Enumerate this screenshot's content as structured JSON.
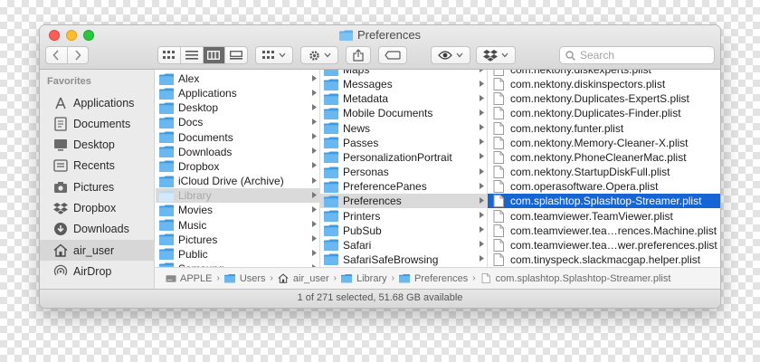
{
  "window": {
    "title": "Preferences"
  },
  "toolbar": {
    "search_placeholder": "Search",
    "back_icon": "chevron-left-icon",
    "forward_icon": "chevron-right-icon",
    "view_modes": [
      "icon-view-icon",
      "list-view-icon",
      "column-view-icon",
      "gallery-view-icon"
    ],
    "active_view": "column-view-icon"
  },
  "sidebar": {
    "heading": "Favorites",
    "items": [
      {
        "label": "Applications",
        "icon": "applications-icon"
      },
      {
        "label": "Documents",
        "icon": "documents-icon"
      },
      {
        "label": "Desktop",
        "icon": "desktop-icon"
      },
      {
        "label": "Recents",
        "icon": "recents-icon"
      },
      {
        "label": "Pictures",
        "icon": "pictures-icon"
      },
      {
        "label": "Dropbox",
        "icon": "dropbox-icon"
      },
      {
        "label": "Downloads",
        "icon": "downloads-icon"
      },
      {
        "label": "air_user",
        "icon": "home-icon",
        "selected": true
      },
      {
        "label": "AirDrop",
        "icon": "airdrop-icon"
      }
    ]
  },
  "columns": {
    "col1": [
      {
        "label": "Alex"
      },
      {
        "label": "Applications"
      },
      {
        "label": "Desktop"
      },
      {
        "label": "Docs"
      },
      {
        "label": "Documents"
      },
      {
        "label": "Downloads"
      },
      {
        "label": "Dropbox"
      },
      {
        "label": "iCloud Drive (Archive)"
      },
      {
        "label": "Library",
        "state": "highlighted"
      },
      {
        "label": "Movies"
      },
      {
        "label": "Music"
      },
      {
        "label": "Pictures"
      },
      {
        "label": "Public"
      },
      {
        "label": "Samsung"
      }
    ],
    "col2": [
      {
        "label": "Maps"
      },
      {
        "label": "Messages"
      },
      {
        "label": "Metadata"
      },
      {
        "label": "Mobile Documents"
      },
      {
        "label": "News"
      },
      {
        "label": "Passes"
      },
      {
        "label": "PersonalizationPortrait"
      },
      {
        "label": "Personas"
      },
      {
        "label": "PreferencePanes"
      },
      {
        "label": "Preferences",
        "state": "highlighted"
      },
      {
        "label": "Printers"
      },
      {
        "label": "PubSub"
      },
      {
        "label": "Safari"
      },
      {
        "label": "SafariSafeBrowsing"
      }
    ],
    "col3": [
      {
        "label": "com.nektony.diskexperts.plist"
      },
      {
        "label": "com.nektony.diskinspectors.plist"
      },
      {
        "label": "com.nektony.Duplicates-ExpertS.plist"
      },
      {
        "label": "com.nektony.Duplicates-Finder.plist"
      },
      {
        "label": "com.nektony.funter.plist"
      },
      {
        "label": "com.nektony.Memory-Cleaner-X.plist"
      },
      {
        "label": "com.nektony.PhoneCleanerMac.plist"
      },
      {
        "label": "com.nektony.StartupDiskFull.plist"
      },
      {
        "label": "com.operasoftware.Opera.plist"
      },
      {
        "label": "com.splashtop.Splashtop-Streamer.plist",
        "state": "selected"
      },
      {
        "label": "com.teamviewer.TeamViewer.plist"
      },
      {
        "label": "com.teamviewer.tea…rences.Machine.plist"
      },
      {
        "label": "com.teamviewer.tea…wer.preferences.plist"
      },
      {
        "label": "com.tinyspeck.slackmacgap.helper.plist"
      }
    ]
  },
  "pathbar": {
    "items": [
      {
        "label": "APPLE",
        "icon": "hard-drive-icon"
      },
      {
        "label": "Users",
        "icon": "folder-icon"
      },
      {
        "label": "air_user",
        "icon": "home-icon"
      },
      {
        "label": "Library",
        "icon": "folder-icon"
      },
      {
        "label": "Preferences",
        "icon": "folder-icon"
      },
      {
        "label": "com.splashtop.Splashtop-Streamer.plist",
        "icon": "document-icon"
      }
    ]
  },
  "status": {
    "text": "1 of 271 selected, 51.68 GB available"
  },
  "colors": {
    "selection": "#1765d4",
    "folder": "#4da6e8",
    "highlight": "#dadada"
  }
}
